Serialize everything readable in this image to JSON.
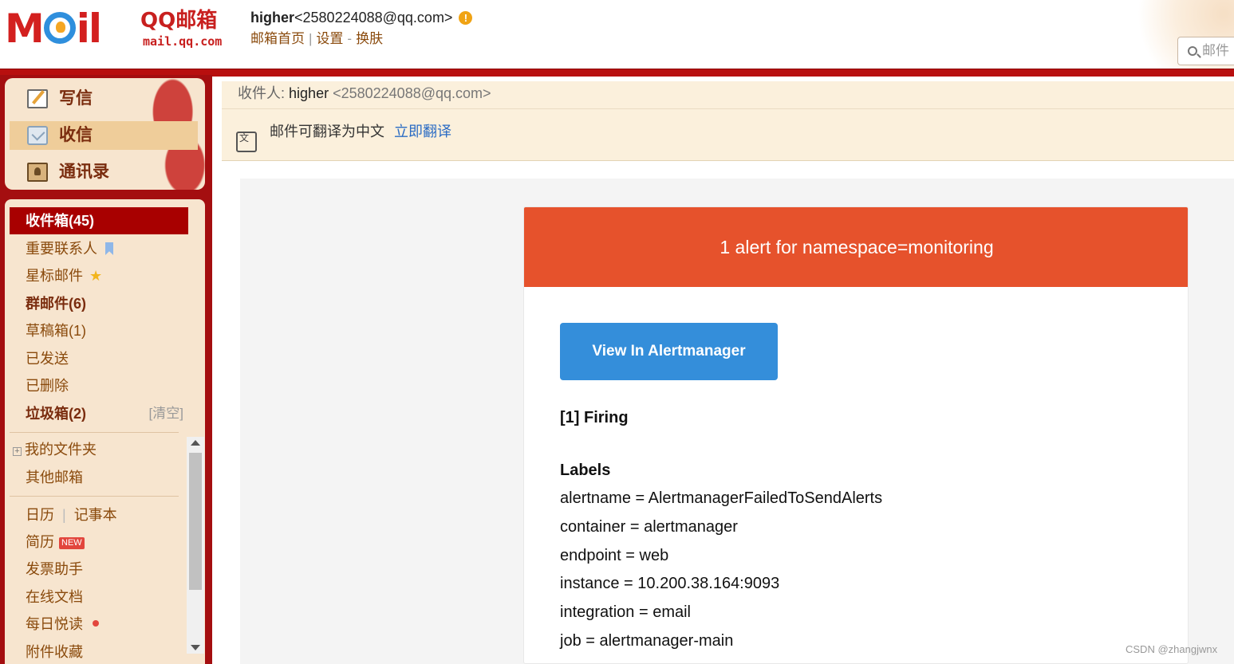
{
  "brand": {
    "logo_mail": "MOil",
    "logo_qq": "QQ邮箱",
    "logo_domain": "mail.qq.com"
  },
  "account": {
    "name": "higher",
    "email": "<2580224088@qq.com>",
    "warning": "!"
  },
  "top_nav": {
    "home": "邮箱首页",
    "sep1": "|",
    "settings": "设置",
    "sep2": "-",
    "skin": "换肤"
  },
  "search": {
    "placeholder": "邮件"
  },
  "sidebar": {
    "compose": "写信",
    "inbox": "收信",
    "contacts": "通讯录",
    "folders": [
      {
        "label": "收件箱(45)"
      },
      {
        "label": "重要联系人"
      },
      {
        "label": "星标邮件"
      },
      {
        "label": "群邮件(6)"
      },
      {
        "label": "草稿箱(1)"
      },
      {
        "label": "已发送"
      },
      {
        "label": "已删除"
      },
      {
        "label": "垃圾箱(2)",
        "action": "[清空]"
      },
      {
        "label": "我的文件夹"
      },
      {
        "label": "其他邮箱"
      },
      {
        "label": "日历",
        "label2": "记事本",
        "sep": "|"
      },
      {
        "label": "简历",
        "badge": "NEW"
      },
      {
        "label": "发票助手"
      },
      {
        "label": "在线文档"
      },
      {
        "label": "每日悦读"
      },
      {
        "label": "附件收藏"
      }
    ],
    "expand_symbol": "+"
  },
  "mail": {
    "recipient_label": "收件人:",
    "recipient_name": "higher",
    "recipient_email": "<2580224088@qq.com>",
    "translate_icon": "文",
    "translate_text": "邮件可翻译为中文",
    "translate_link": "立即翻译",
    "alert_title": "1 alert for namespace=monitoring",
    "button_label": "View In Alertmanager",
    "firing": "[1] Firing",
    "labels_title": "Labels",
    "labels": [
      "alertname = AlertmanagerFailedToSendAlerts",
      "container = alertmanager",
      "endpoint = web",
      "instance = 10.200.38.164:9093",
      "integration = email",
      "job = alertmanager-main"
    ]
  },
  "watermark": "CSDN @zhangjwnx",
  "colors": {
    "brand_red": "#b80f0f",
    "alert_banner": "#e6522c",
    "button_blue": "#348eda",
    "link_blue": "#2b6cc4"
  }
}
